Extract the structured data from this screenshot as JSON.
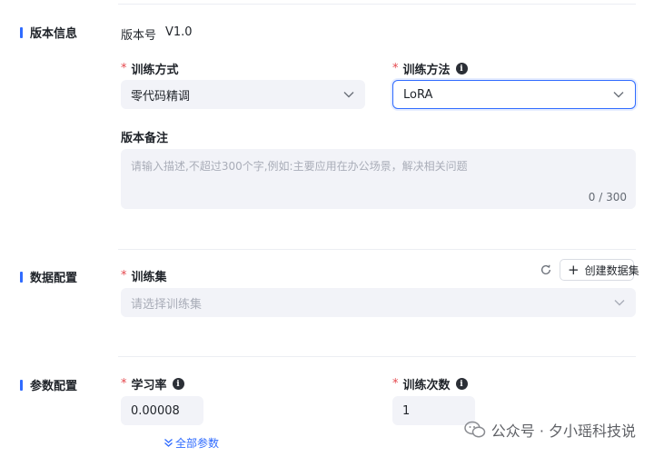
{
  "sections": {
    "version_info": "版本信息",
    "data_config": "数据配置",
    "param_config": "参数配置"
  },
  "version": {
    "label": "版本号",
    "value": "V1.0"
  },
  "train_mode": {
    "label": "训练方式",
    "value": "零代码精调"
  },
  "train_method": {
    "label": "训练方法",
    "value": "LoRA"
  },
  "remark": {
    "label": "版本备注",
    "placeholder": "请输入描述,不超过300个字,例如:主要应用在办公场景，解决相关问题",
    "counter": "0 / 300"
  },
  "dataset": {
    "label": "训练集",
    "placeholder": "请选择训练集",
    "create_button": "创建数据集"
  },
  "learning_rate": {
    "label": "学习率",
    "value": "0.00008"
  },
  "epochs": {
    "label": "训练次数",
    "value": "1"
  },
  "all_params_link": "全部参数",
  "watermark": "公众号 · 夕小瑶科技说",
  "colors": {
    "accent": "#2f6bff",
    "required": "#e5484d",
    "field_bg": "#f2f3f8"
  }
}
